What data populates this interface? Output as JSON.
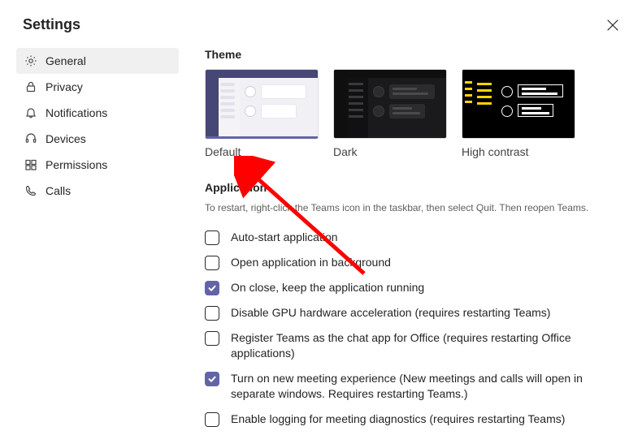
{
  "header": {
    "title": "Settings"
  },
  "sidebar": {
    "items": [
      {
        "key": "general",
        "label": "General",
        "icon": "gear-icon",
        "selected": true
      },
      {
        "key": "privacy",
        "label": "Privacy",
        "icon": "lock-icon",
        "selected": false
      },
      {
        "key": "notifications",
        "label": "Notifications",
        "icon": "bell-icon",
        "selected": false
      },
      {
        "key": "devices",
        "label": "Devices",
        "icon": "headset-icon",
        "selected": false
      },
      {
        "key": "permissions",
        "label": "Permissions",
        "icon": "permissions-icon",
        "selected": false
      },
      {
        "key": "calls",
        "label": "Calls",
        "icon": "phone-icon",
        "selected": false
      }
    ]
  },
  "theme": {
    "heading": "Theme",
    "options": [
      {
        "key": "default",
        "label": "Default",
        "selected": true
      },
      {
        "key": "dark",
        "label": "Dark",
        "selected": false
      },
      {
        "key": "high_contrast",
        "label": "High contrast",
        "selected": false
      }
    ]
  },
  "application": {
    "heading": "Application",
    "description": "To restart, right-click the Teams icon in the taskbar, then select Quit. Then reopen Teams.",
    "options": [
      {
        "key": "auto_start",
        "label": "Auto-start application",
        "checked": false
      },
      {
        "key": "open_bg",
        "label": "Open application in background",
        "checked": false
      },
      {
        "key": "on_close",
        "label": "On close, keep the application running",
        "checked": true
      },
      {
        "key": "disable_gpu",
        "label": "Disable GPU hardware acceleration (requires restarting Teams)",
        "checked": false
      },
      {
        "key": "register_chat",
        "label": "Register Teams as the chat app for Office (requires restarting Office applications)",
        "checked": false
      },
      {
        "key": "new_meeting",
        "label": "Turn on new meeting experience (New meetings and calls will open in separate windows. Requires restarting Teams.)",
        "checked": true
      },
      {
        "key": "logging",
        "label": "Enable logging for meeting diagnostics (requires restarting Teams)",
        "checked": false
      }
    ]
  },
  "colors": {
    "accent": "#6264a7",
    "annotation_arrow": "#ff0000"
  }
}
